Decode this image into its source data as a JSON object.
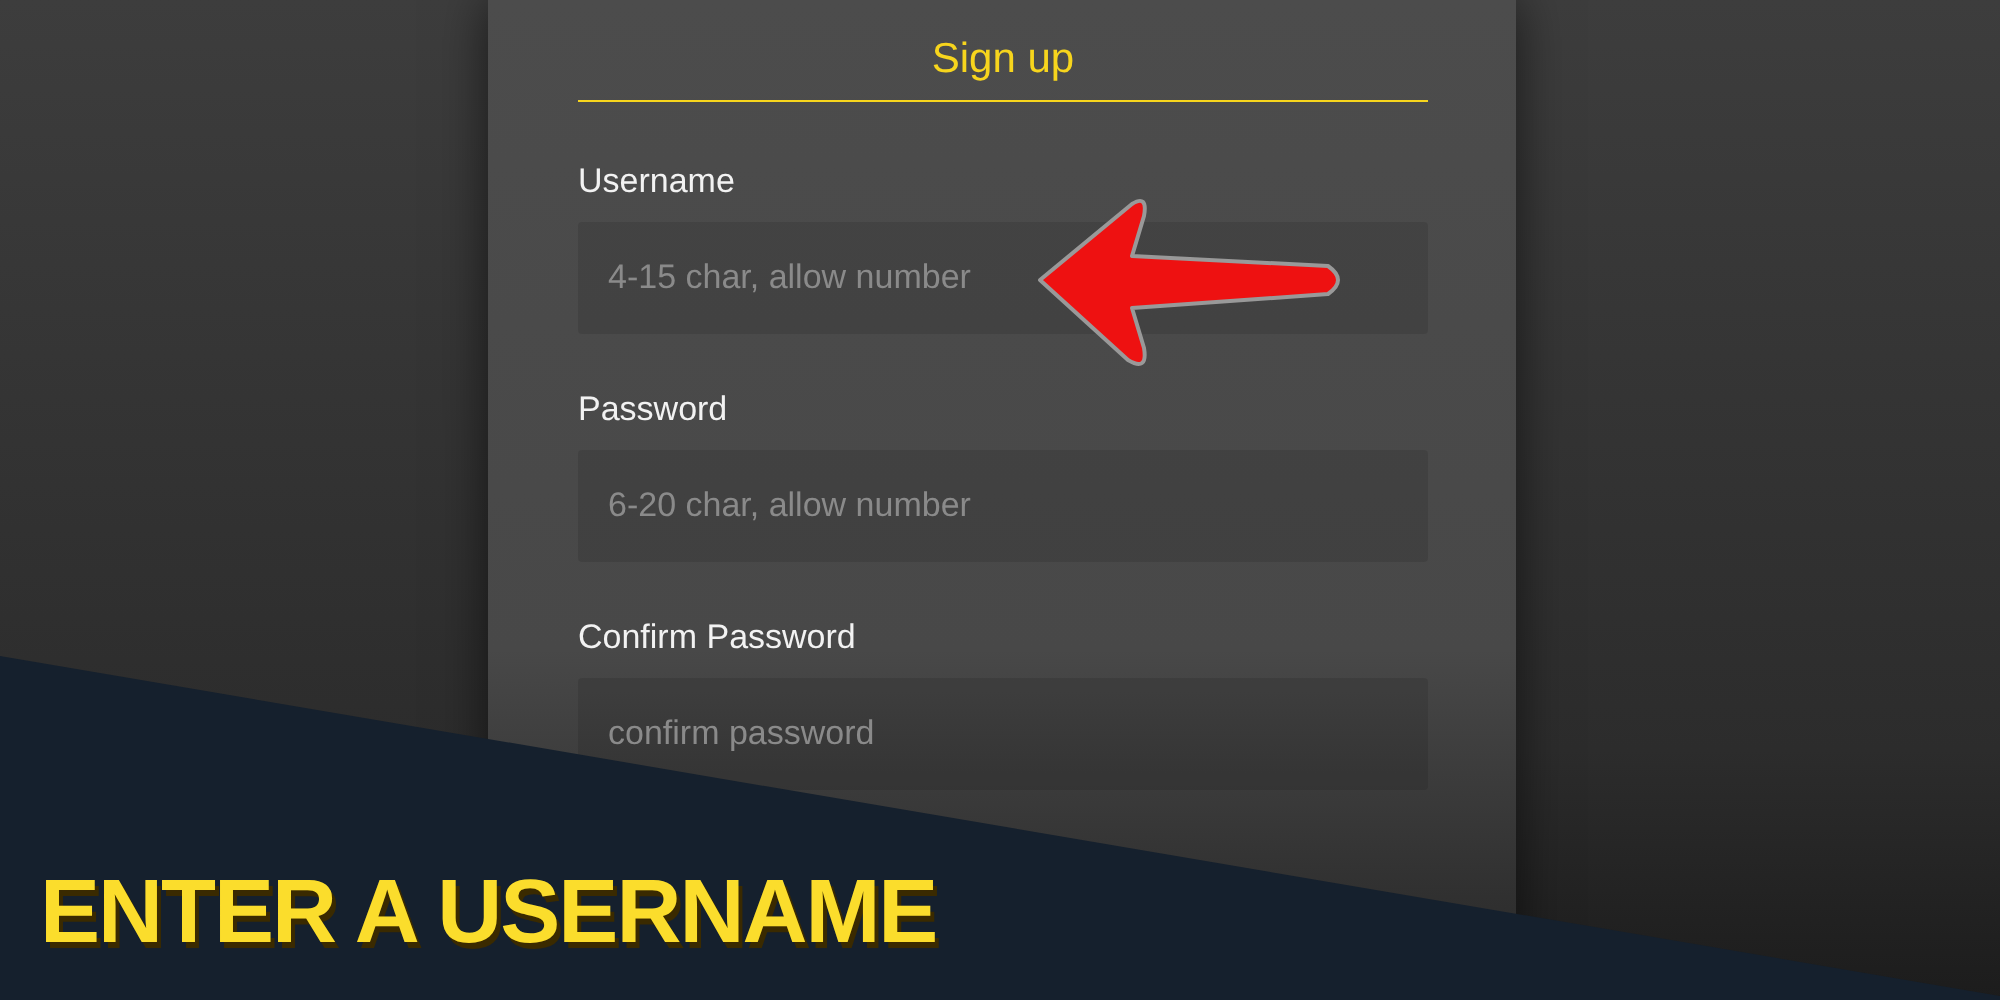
{
  "form": {
    "title": "Sign up",
    "fields": [
      {
        "label": "Username",
        "placeholder": "4-15 char, allow number"
      },
      {
        "label": "Password",
        "placeholder": "6-20 char, allow number"
      },
      {
        "label": "Confirm Password",
        "placeholder": "confirm password"
      }
    ]
  },
  "banner": {
    "caption": "ENTER A USERNAME"
  }
}
